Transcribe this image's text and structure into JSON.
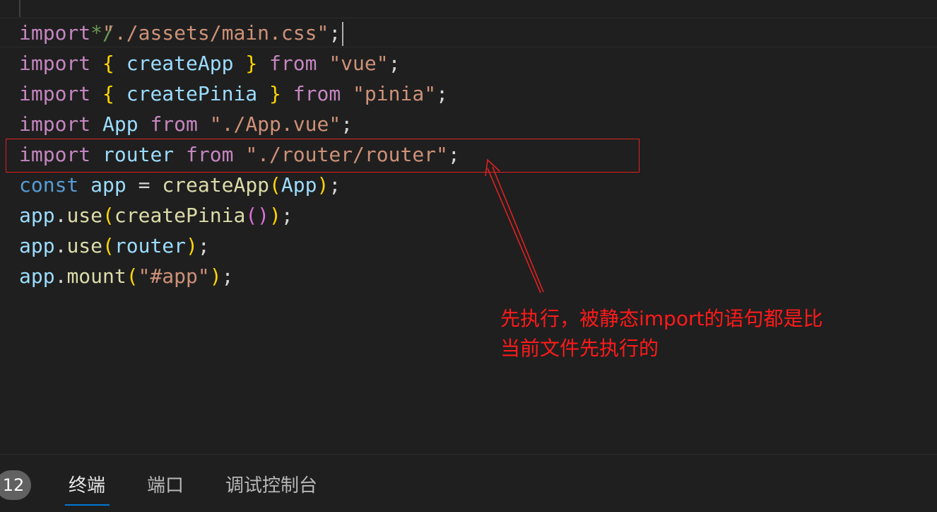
{
  "editor": {
    "comment_tail": "*/",
    "lines": [
      [
        {
          "t": "import",
          "c": "kw-import"
        },
        {
          "t": " ",
          "c": "punct"
        },
        {
          "t": "\"./assets/main.css\"",
          "c": "str"
        },
        {
          "t": ";",
          "c": "punct"
        }
      ],
      [
        {
          "t": "import",
          "c": "kw-import"
        },
        {
          "t": " ",
          "c": "punct"
        },
        {
          "t": "{",
          "c": "b1"
        },
        {
          "t": " createApp ",
          "c": "var"
        },
        {
          "t": "}",
          "c": "b1"
        },
        {
          "t": " ",
          "c": "punct"
        },
        {
          "t": "from",
          "c": "kw-import"
        },
        {
          "t": " ",
          "c": "punct"
        },
        {
          "t": "\"vue\"",
          "c": "str"
        },
        {
          "t": ";",
          "c": "punct"
        }
      ],
      [
        {
          "t": "import",
          "c": "kw-import"
        },
        {
          "t": " ",
          "c": "punct"
        },
        {
          "t": "{",
          "c": "b1"
        },
        {
          "t": " createPinia ",
          "c": "var"
        },
        {
          "t": "}",
          "c": "b1"
        },
        {
          "t": " ",
          "c": "punct"
        },
        {
          "t": "from",
          "c": "kw-import"
        },
        {
          "t": " ",
          "c": "punct"
        },
        {
          "t": "\"pinia\"",
          "c": "str"
        },
        {
          "t": ";",
          "c": "punct"
        }
      ],
      [
        {
          "t": "import",
          "c": "kw-import"
        },
        {
          "t": " ",
          "c": "punct"
        },
        {
          "t": "App",
          "c": "cls"
        },
        {
          "t": " ",
          "c": "punct"
        },
        {
          "t": "from",
          "c": "kw-import"
        },
        {
          "t": " ",
          "c": "punct"
        },
        {
          "t": "\"./App.vue\"",
          "c": "str"
        },
        {
          "t": ";",
          "c": "punct"
        }
      ],
      [
        {
          "t": "import",
          "c": "kw-import"
        },
        {
          "t": " ",
          "c": "punct"
        },
        {
          "t": "router",
          "c": "var"
        },
        {
          "t": " ",
          "c": "punct"
        },
        {
          "t": "from",
          "c": "kw-import"
        },
        {
          "t": " ",
          "c": "punct"
        },
        {
          "t": "\"./router/router\"",
          "c": "str"
        },
        {
          "t": ";",
          "c": "punct"
        }
      ],
      [
        {
          "t": "const",
          "c": "kw-decl"
        },
        {
          "t": " ",
          "c": "punct"
        },
        {
          "t": "app",
          "c": "var"
        },
        {
          "t": " = ",
          "c": "punct"
        },
        {
          "t": "createApp",
          "c": "fn"
        },
        {
          "t": "(",
          "c": "b1"
        },
        {
          "t": "App",
          "c": "cls"
        },
        {
          "t": ")",
          "c": "b1"
        },
        {
          "t": ";",
          "c": "punct"
        }
      ],
      [
        {
          "t": "app",
          "c": "var"
        },
        {
          "t": ".",
          "c": "punct"
        },
        {
          "t": "use",
          "c": "fn"
        },
        {
          "t": "(",
          "c": "b1"
        },
        {
          "t": "createPinia",
          "c": "fn"
        },
        {
          "t": "()",
          "c": "b2"
        },
        {
          "t": ")",
          "c": "b1"
        },
        {
          "t": ";",
          "c": "punct"
        }
      ],
      [
        {
          "t": "app",
          "c": "var"
        },
        {
          "t": ".",
          "c": "punct"
        },
        {
          "t": "use",
          "c": "fn"
        },
        {
          "t": "(",
          "c": "b1"
        },
        {
          "t": "router",
          "c": "var"
        },
        {
          "t": ")",
          "c": "b1"
        },
        {
          "t": ";",
          "c": "punct"
        }
      ],
      [
        {
          "t": "app",
          "c": "var"
        },
        {
          "t": ".",
          "c": "punct"
        },
        {
          "t": "mount",
          "c": "fn"
        },
        {
          "t": "(",
          "c": "b1"
        },
        {
          "t": "\"#app\"",
          "c": "str"
        },
        {
          "t": ")",
          "c": "b1"
        },
        {
          "t": ";",
          "c": "punct"
        }
      ]
    ]
  },
  "annotation": {
    "line1": "先执行，被静态import的语句都是比",
    "line2": "当前文件先执行的",
    "color": "#ff1a1a"
  },
  "panel": {
    "badge": "12",
    "tabs": [
      {
        "label": "终端",
        "active": true
      },
      {
        "label": "端口",
        "active": false
      },
      {
        "label": "调试控制台",
        "active": false
      }
    ],
    "accent": "#0078d4"
  }
}
